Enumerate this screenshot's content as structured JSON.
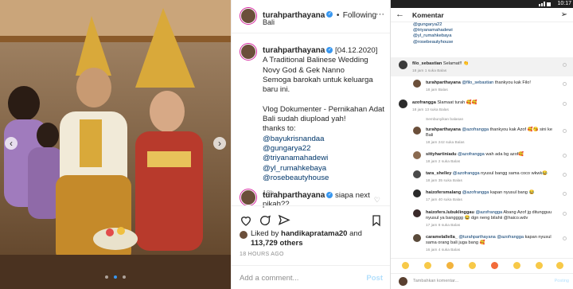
{
  "post": {
    "username": "turahparthayana",
    "separator": "•",
    "follow_label": "Following",
    "location": "Bali",
    "caption_lines": [
      "[04.12.2020]",
      "A Traditional Balinese Wedding",
      "Novy God & Gek Nanno",
      "Semoga barokah untuk keluarga",
      "baru ini.",
      "",
      "Vlog Dokumenter - Pernikahan Adat",
      "Bali sudah diupload yah!",
      "thanks to:"
    ],
    "caption_links": [
      "@bayukrisnandaa",
      "@gungarya22",
      "@triyanamahadewi",
      "@yl_rumahkebaya",
      "@rosebeautyhouse"
    ],
    "caption_time": "18h",
    "reply_username": "turahparthayana",
    "reply_text": "siapa next pikah??",
    "liked_by_prefix": "Liked by ",
    "liked_by_user": "handikapratama20",
    "liked_by_and": " and",
    "likes_count": "113,729",
    "likes_suffix": " others",
    "timestamp": "18 HOURS AGO",
    "add_comment_placeholder": "Add a comment...",
    "post_label": "Post"
  },
  "phone": {
    "time": "10:17",
    "title": "Komentar",
    "top_links": [
      "@gungarya22",
      "@triyanamahadewi",
      "@yl_rumahkebaya",
      "@rosebeautyhouse"
    ],
    "hide_replies": "Sembunyikan balasan",
    "comments": [
      {
        "user": "filo_sebastian",
        "mention": "",
        "text": "Selamat!! 👏",
        "meta": "18 jam   1 suka   Balas"
      },
      {
        "user": "turahparthayana",
        "mention": "@filo_sebastian",
        "text": "thankyou kak Filo!",
        "meta": "18 jam   Balas"
      },
      {
        "user": "azofrangga",
        "mention": "",
        "text": "Slamaat turah 🥰🥰",
        "meta": "18 jam   13 suka   Balas"
      },
      {
        "user": "turahparthayana",
        "mention": "@azofrangga",
        "text": "thankyou kak Azof 🥰😘 sini ke Bali",
        "meta": "18 jam   242 suka   Balas"
      },
      {
        "user": "sittyhartiniadu",
        "mention": "@azofrangga",
        "text": "wah ada bg azof🥰",
        "meta": "18 jam   2 suka   Balas"
      },
      {
        "user": "tara_shelley",
        "mention": "@azofrangga",
        "text": "nyusul bangg sama coco wkwk😂",
        "meta": "18 jam   35 suka   Balas"
      },
      {
        "user": "haizofersmalang",
        "mention": "@azofrangga",
        "text": "kapan nyusul bang 😂",
        "meta": "17 jam   40 suka   Balas"
      },
      {
        "user": "haizofers.lubuklinggau",
        "mention": "@azofrangga",
        "text": "Abang Azof jg ditungguu nyusul ya bangggg 😂 dgn neng bilahii @haico.wdv",
        "meta": "17 jam   8 suka   Balas"
      },
      {
        "user": "caramelallella_",
        "mention": "@turahparthayana @azofrangga",
        "text": "kapan nyusul sama orang bali juga bang 🥰",
        "meta": "16 jam   4 suka   Balas"
      }
    ],
    "input_placeholder": "Tambahkan komentar...",
    "post_label": "Posting"
  },
  "colors": {
    "link": "#00376b",
    "verified": "#3897f0",
    "muted": "#8e8e8e"
  }
}
